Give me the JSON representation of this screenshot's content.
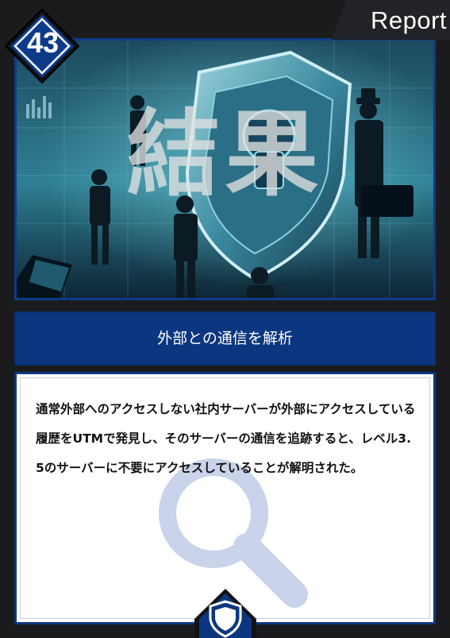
{
  "card": {
    "cost": "43",
    "category_label": "Report",
    "art_title": "結果",
    "subtitle": "外部との通信を解析",
    "description": "通常外部へのアクセスしない社内サーバーが外部にアクセスしている履歴をUTMで発見し、そのサーバーの通信を追跡すると、レベル3.5のサーバーに不要にアクセスしていることが解明された。"
  },
  "colors": {
    "frame": "#1b1b1d",
    "accent_blue": "#0c3780",
    "diamond_blue": "#0d3b8a",
    "magnifier": "#c9d3ea"
  },
  "icons": {
    "cost": "diamond-badge",
    "watermark": "magnifier-icon",
    "footer": "shield-icon"
  }
}
